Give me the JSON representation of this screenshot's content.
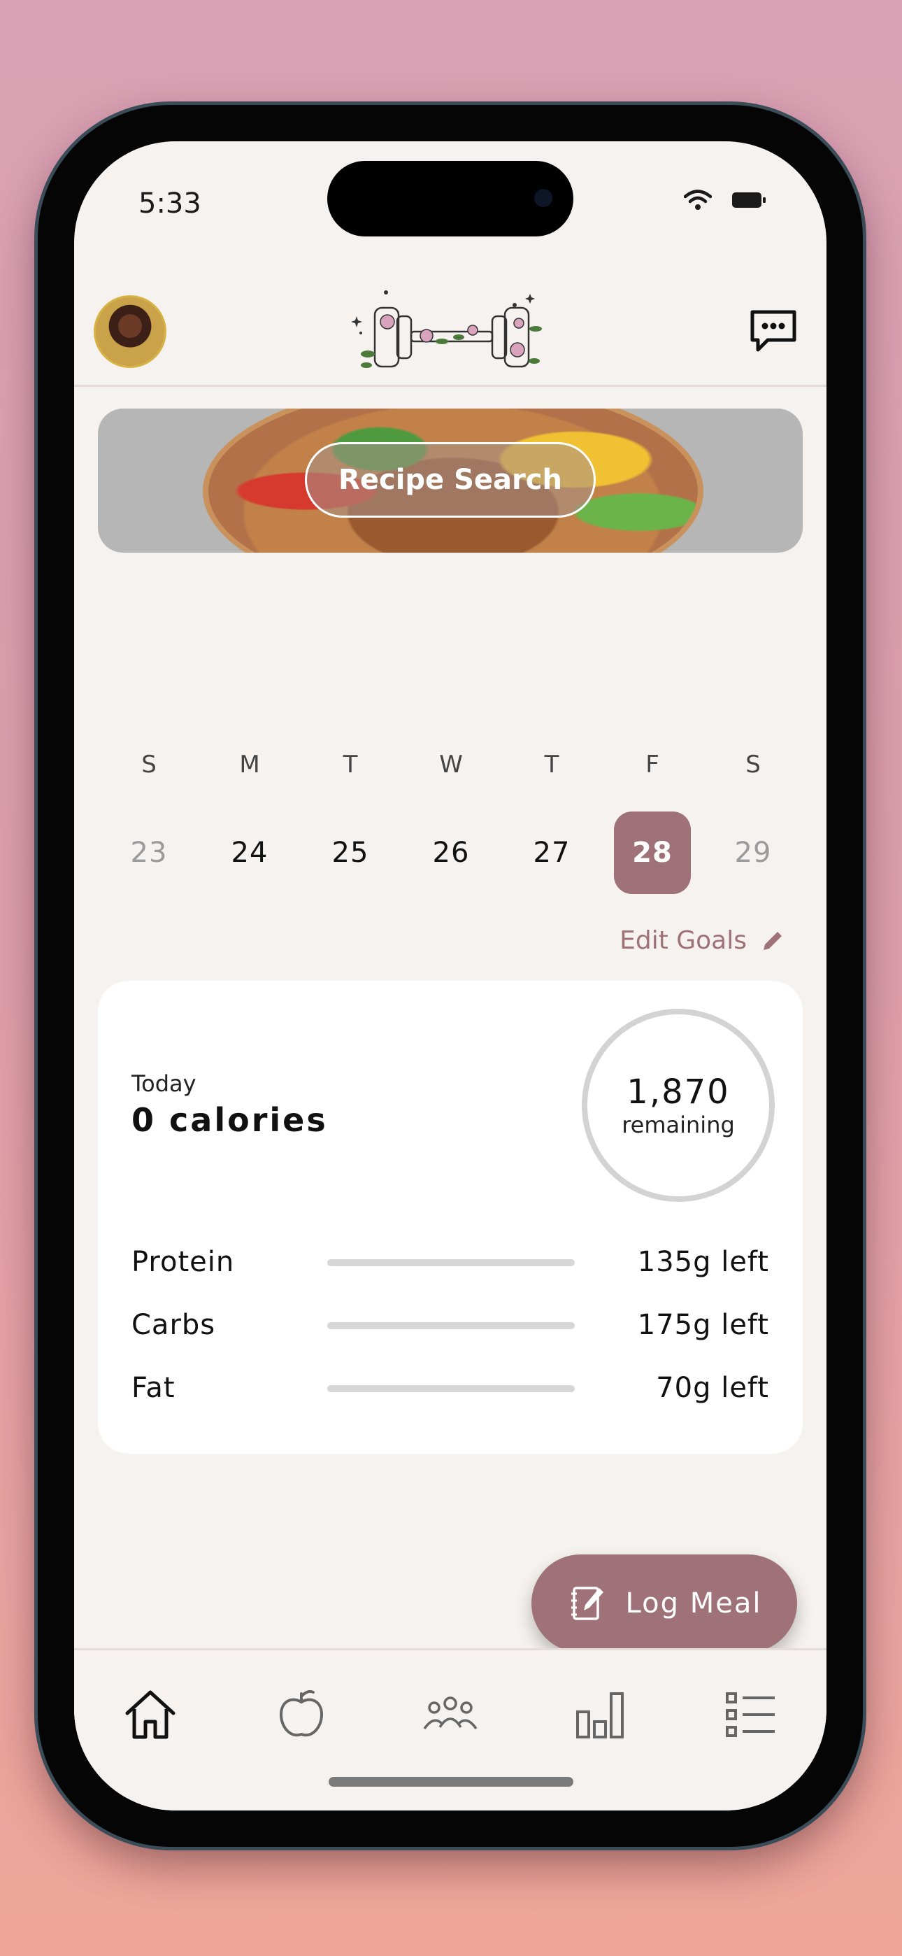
{
  "status_bar": {
    "time": "5:33"
  },
  "banner": {
    "recipe_search_label": "Recipe Search"
  },
  "week": {
    "days": [
      {
        "dow": "S",
        "date": "23",
        "state": "muted"
      },
      {
        "dow": "M",
        "date": "24",
        "state": "normal"
      },
      {
        "dow": "T",
        "date": "25",
        "state": "normal"
      },
      {
        "dow": "W",
        "date": "26",
        "state": "normal"
      },
      {
        "dow": "T",
        "date": "27",
        "state": "normal"
      },
      {
        "dow": "F",
        "date": "28",
        "state": "selected"
      },
      {
        "dow": "S",
        "date": "29",
        "state": "muted"
      }
    ]
  },
  "goals": {
    "edit_label": "Edit Goals"
  },
  "summary": {
    "today_label": "Today",
    "calories": "0 calories",
    "remaining_value": "1,870",
    "remaining_label": "remaining",
    "remaining_progress": 0
  },
  "macros": [
    {
      "name": "Protein",
      "left": "135g left",
      "progress": 0
    },
    {
      "name": "Carbs",
      "left": "175g left",
      "progress": 0
    },
    {
      "name": "Fat",
      "left": "70g left",
      "progress": 0
    }
  ],
  "actions": {
    "log_meal_label": "Log Meal"
  },
  "tabbar": {
    "items": [
      {
        "icon": "home-icon",
        "active": true
      },
      {
        "icon": "apple-icon",
        "active": false
      },
      {
        "icon": "community-icon",
        "active": false
      },
      {
        "icon": "stats-icon",
        "active": false
      },
      {
        "icon": "list-icon",
        "active": false
      }
    ]
  },
  "colors": {
    "accent": "#9e7278",
    "background": "#f6f2ef",
    "card": "#ffffff",
    "track": "#d6d6d6"
  }
}
